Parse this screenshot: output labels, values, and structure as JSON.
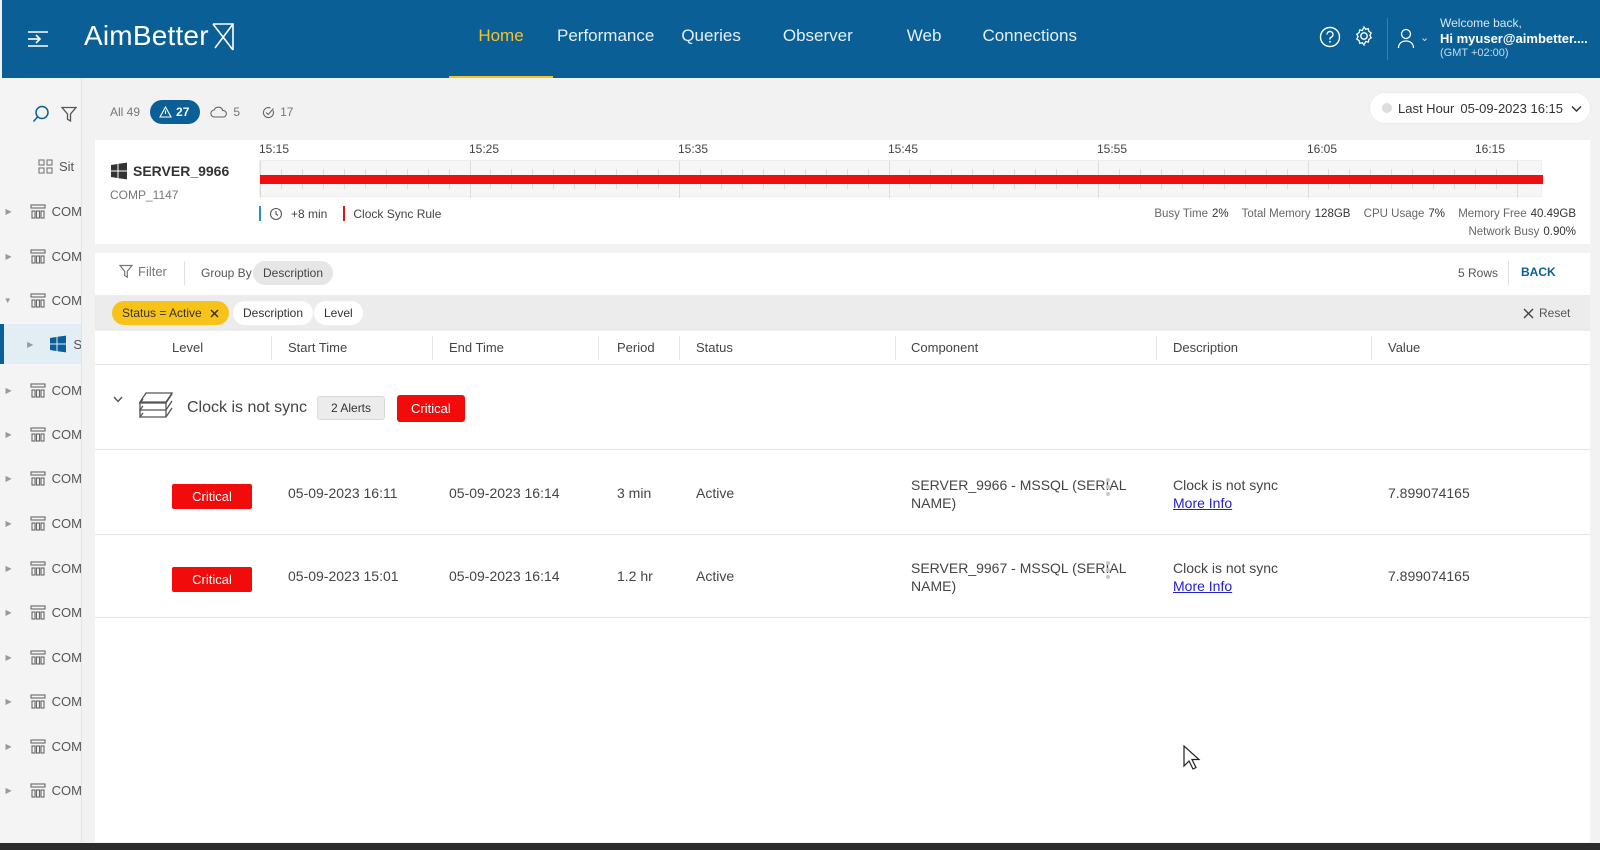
{
  "header": {
    "logo": "AimBetter",
    "nav": [
      "Home",
      "Performance",
      "Queries",
      "Observer",
      "Web",
      "Connections"
    ],
    "active_nav": "Home",
    "welcome": "Welcome back,",
    "user": "Hi myuser@aimbetter....",
    "timezone": "(GMT +02:00)"
  },
  "sidebar": {
    "site_label": "Sit",
    "items": [
      "COM",
      "COM",
      "COM",
      "S",
      "COM",
      "COM",
      "COM",
      "COM",
      "COM",
      "COM",
      "COM",
      "COM",
      "COM",
      "COM"
    ]
  },
  "filters": {
    "all_label": "All 49",
    "active_count": "27",
    "cloud_count": "5",
    "check_count": "17"
  },
  "time_selector": {
    "range": "Last Hour",
    "datetime": "05-09-2023 16:15"
  },
  "server": {
    "name": "SERVER_9966",
    "computer": "COMP_1147",
    "ticks": [
      "15:15",
      "15:25",
      "15:35",
      "15:45",
      "15:55",
      "16:05",
      "16:15"
    ],
    "legend_offset": "+8 min",
    "legend_rule": "Clock Sync Rule",
    "stats": {
      "busy_time_label": "Busy Time",
      "busy_time": "2%",
      "total_memory_label": "Total Memory",
      "total_memory": "128GB",
      "cpu_label": "CPU Usage",
      "cpu": "7%",
      "memory_free_label": "Memory Free",
      "memory_free": "40.49GB",
      "network_label": "Network Busy",
      "network": "0.90%"
    }
  },
  "table_toolbar": {
    "filter_label": "Filter",
    "group_by_label": "Group By",
    "group_by_value": "Description",
    "rows_label": "5 Rows",
    "back_label": "BACK"
  },
  "chips": {
    "status": "Status = Active",
    "description": "Description",
    "level": "Level",
    "reset": "Reset"
  },
  "columns": [
    "Level",
    "Start Time",
    "End Time",
    "Period",
    "Status",
    "Component",
    "Description",
    "Value"
  ],
  "group": {
    "title": "Clock is not sync",
    "count": "2 Alerts",
    "level": "Critical"
  },
  "rows": [
    {
      "level": "Critical",
      "start": "05-09-2023 16:11",
      "end": "05-09-2023 16:14",
      "period": "3 min",
      "status": "Active",
      "component_l1": "SERVER_9966 - MSSQL (SERIAL",
      "component_l2": "NAME)",
      "description": "Clock is not sync",
      "more": "More Info",
      "value": "7.899074165"
    },
    {
      "level": "Critical",
      "start": "05-09-2023 15:01",
      "end": "05-09-2023 16:14",
      "period": "1.2 hr",
      "status": "Active",
      "component_l1": "SERVER_9967 - MSSQL (SERIAL",
      "component_l2": "NAME)",
      "description": "Clock is not sync",
      "more": "More Info",
      "value": "7.899074165"
    }
  ],
  "colors": {
    "header_bg": "#0a6096",
    "accent": "#f7c12c",
    "critical": "#f10b0b",
    "status_chip": "#f8c319"
  }
}
